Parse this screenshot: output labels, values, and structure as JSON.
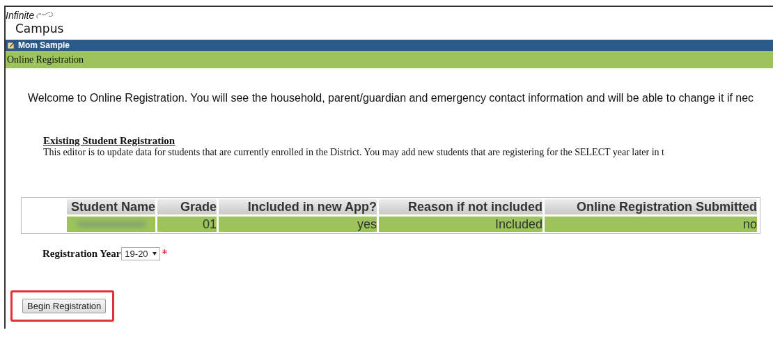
{
  "logo": {
    "line_1": "Infinite",
    "line_2": "Campus"
  },
  "user_bar": {
    "name": "Mom Sample"
  },
  "page_title": "Online Registration",
  "welcome": "Welcome to Online Registration. You will see the household, parent/guardian and emergency contact information and will be able to change it if nec",
  "section": {
    "title": "Existing Student Registration",
    "description": "This editor is to update data for students that are currently enrolled in the District. You may add new students that are registering for the SELECT year later in t"
  },
  "table": {
    "columns": [
      "Student Name",
      "Grade",
      "Included in new App?",
      "Reason if not included",
      "Online Registration Submitted"
    ],
    "rows": [
      {
        "name_blurred": true,
        "cells": [
          "",
          "01",
          "yes",
          "Included",
          "no"
        ]
      }
    ]
  },
  "registration_year": {
    "label": "Registration Year",
    "value": "19-20",
    "required": true
  },
  "begin_button": {
    "label": "Begin Registration",
    "highlighted": true
  }
}
